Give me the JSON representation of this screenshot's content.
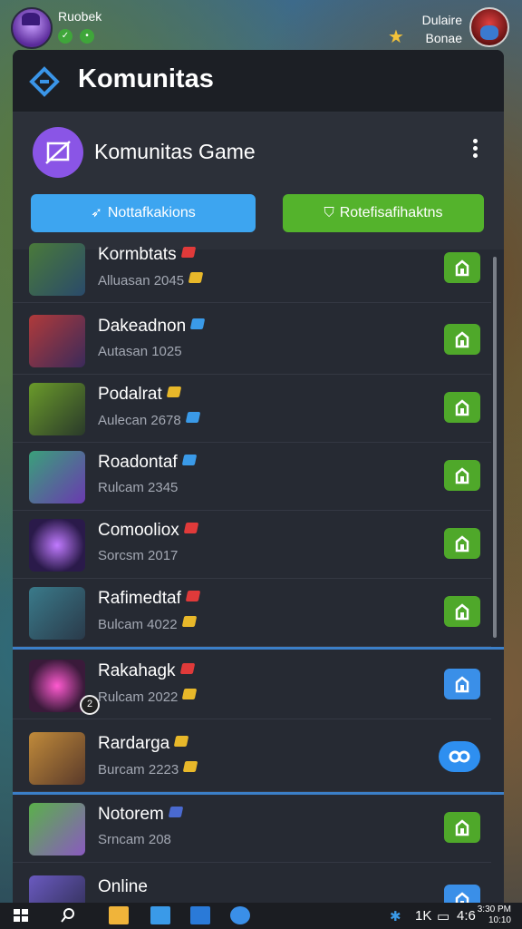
{
  "top_bar": {
    "username": "Ruobek",
    "right_text_1": "Dulaire",
    "right_text_2": "Bonae"
  },
  "panel": {
    "title": "Komunitas",
    "community_title": "Komunitas Game",
    "notifications_button": "Nottafkakions",
    "second_button": "Rotefisafihaktns"
  },
  "list": [
    {
      "name": "Kormbtats",
      "sub": "Alluasan 2045",
      "gem": "#e03a3a",
      "sub_gem": "#e8b82a",
      "action": "green"
    },
    {
      "name": "Dakeadnon",
      "sub": "Autasan 1025",
      "gem": "#3a9ae8",
      "sub_gem": "",
      "action": "green"
    },
    {
      "name": "Podalrat",
      "sub": "Aulecan 2678",
      "gem": "#e8b82a",
      "sub_gem": "#3a9ae8",
      "action": "green"
    },
    {
      "name": "Roadontaf",
      "sub": "Rulcam 2345",
      "gem": "#3a9ae8",
      "sub_gem": "",
      "action": "green"
    },
    {
      "name": "Comooliox",
      "sub": "Sorcsm 2017",
      "gem": "#e03a3a",
      "sub_gem": "",
      "action": "green"
    },
    {
      "name": "Rafimedtaf",
      "sub": "Bulcam 4022",
      "gem": "#e03a3a",
      "sub_gem": "#e8b82a",
      "action": "green"
    },
    {
      "name": "Rakahagk",
      "sub": "Rulcam 2022",
      "gem": "#e03a3a",
      "sub_gem": "#e8b82a",
      "action": "blue",
      "badge": "2"
    },
    {
      "name": "Rardarga",
      "sub": "Burcam 2223",
      "gem": "#e8b82a",
      "sub_gem": "#e8b82a",
      "action": "pill"
    },
    {
      "name": "Notorem",
      "sub": "Srncam 208",
      "gem": "#4a6ad0",
      "sub_gem": "",
      "action": "green"
    },
    {
      "name": "Online",
      "sub": "",
      "gem": "",
      "sub_gem": "",
      "action": "blue"
    }
  ],
  "taskbar": {
    "tray_text_1": "1K",
    "tray_text_2": "4:6",
    "clock_line_1": "3:30 PM",
    "clock_line_2": "10:10"
  },
  "colors": {
    "panel": "#262a33",
    "header": "#1c1f25",
    "accent_blue": "#3da5f0",
    "accent_green": "#54b32c",
    "separator": "#3b7fc8"
  }
}
